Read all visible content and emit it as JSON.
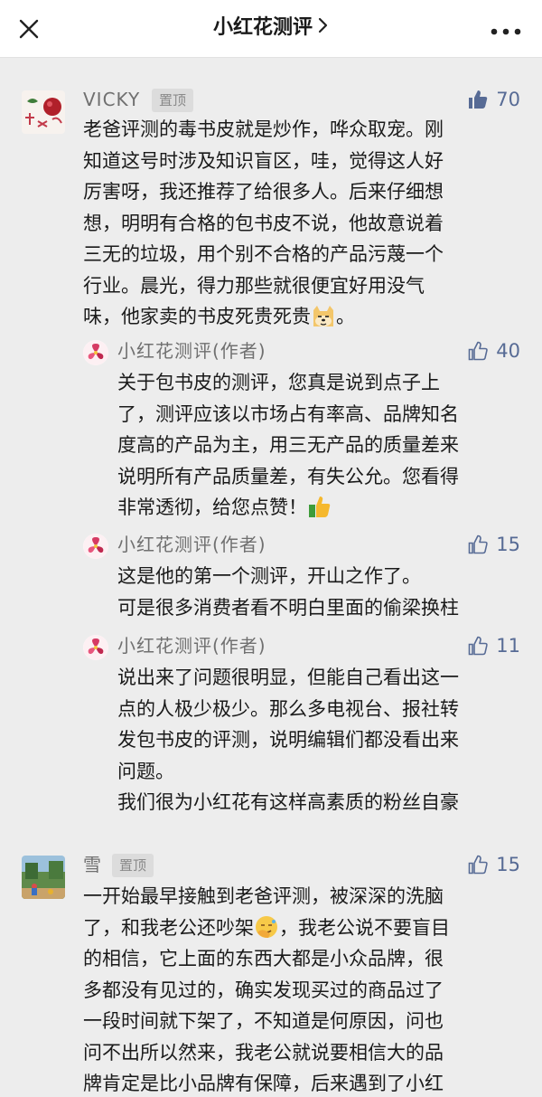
{
  "header": {
    "title": "小红花测评",
    "close_icon": "close-icon",
    "chevron_icon": "chevron-right-icon",
    "more_icon": "more-icon"
  },
  "colors": {
    "link": "#576b95",
    "background": "#ededed"
  },
  "comments": [
    {
      "name": "VICKY",
      "pin_label": "置顶",
      "likes": "70",
      "text_lines": [
        "老爸评测的毒书皮就是炒作，哗众取宠。刚",
        "知道这号时涉及知识盲区，哇，觉得这人好",
        "厉害呀，我还推荐了给很多人。后来仔细想",
        "想，明明有合格的包书皮不说，他故意说着",
        "三无的垃圾，用个别不合格的产品污蔑一个",
        "行业。晨光，得力那些就很便宜好用没气",
        "味，他家卖的书皮死贵死贵"
      ],
      "text_tail": "。",
      "emoji_icon": "doge-emoji-icon"
    },
    {
      "name": "雪",
      "pin_label": "置顶",
      "likes": "15",
      "text_lines": [
        "一开始最早接触到老爸评测，被深深的洗脑",
        "了，和我老公还吵架",
        "的相信，它上面的东西大都是小众品牌，很",
        "多都没有见过的，确实发现买过的商品过了",
        "一段时间就下架了，不知道是何原因，问也",
        "问不出所以然来，我老公就说要相信大的品",
        "牌肯定是比小品牌有保障，后来遇到了小红"
      ],
      "line2_tail": "，我老公说不要盲目",
      "emoji_icon": "facepalm-emoji-icon"
    }
  ],
  "replies": [
    {
      "name": "小红花测评(作者)",
      "likes": "40",
      "text_lines": [
        "关于包书皮的测评，您真是说到点子上",
        "了，测评应该以市场占有率高、品牌知名",
        "度高的产品为主，用三无产品的质量差来",
        "说明所有产品质量差，有失公允。您看得",
        "非常透彻，给您点赞！"
      ],
      "emoji_icon": "thumbs-up-emoji-icon"
    },
    {
      "name": "小红花测评(作者)",
      "likes": "15",
      "text_lines": [
        "这是他的第一个测评，开山之作了。",
        "可是很多消费者看不明白里面的偷梁换柱"
      ]
    },
    {
      "name": "小红花测评(作者)",
      "likes": "11",
      "text_lines": [
        "说出来了问题很明显，但能自己看出这一",
        "点的人极少极少。那么多电视台、报社转",
        "发包书皮的评测，说明编辑们都没看出来",
        "问题。",
        "我们很为小红花有这样高素质的粉丝自豪"
      ]
    }
  ]
}
